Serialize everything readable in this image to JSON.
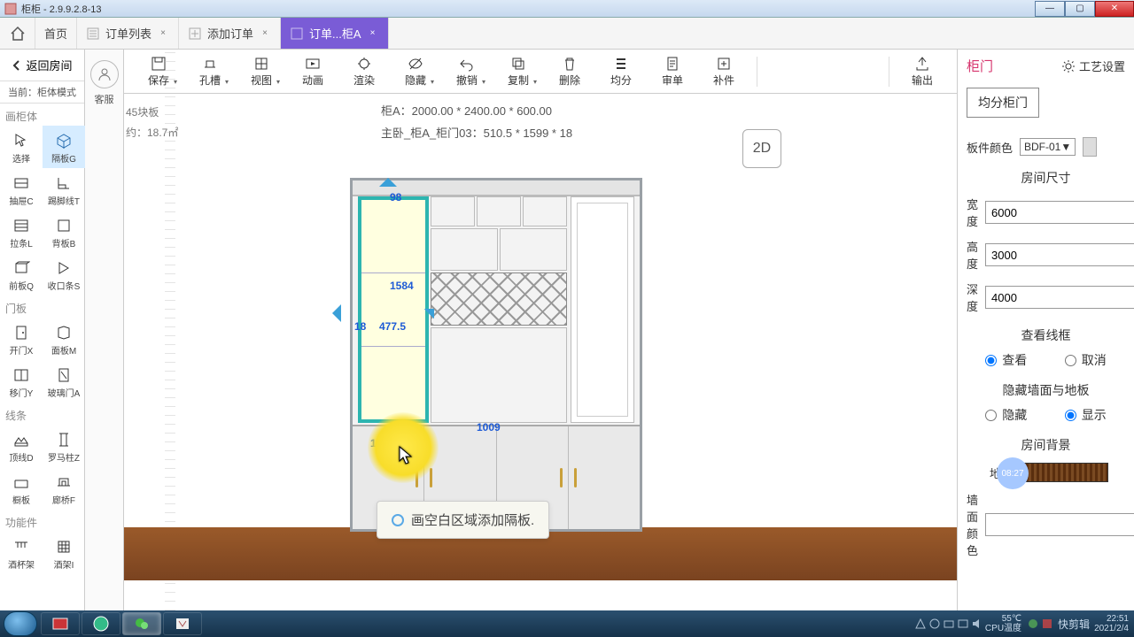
{
  "app": {
    "title": "柜柜 - 2.9.9.2.8-13"
  },
  "window_controls": {
    "min": "—",
    "max": "▢",
    "close": "✕"
  },
  "tabs": {
    "home": "首页",
    "list": {
      "label": "订单列表",
      "closable": true
    },
    "add": {
      "label": "添加订单",
      "closable": true
    },
    "active": {
      "label": "订单...柜A",
      "closable": true
    }
  },
  "left": {
    "back": "返回房间",
    "mode": "当前：柜体模式",
    "service": "客服",
    "sect_body": "画柜体",
    "tools_body": [
      [
        "选择",
        "隔板G"
      ],
      [
        "抽屉C",
        "踢脚线T"
      ],
      [
        "拉条L",
        "背板B"
      ],
      [
        "前板Q",
        "收口条S"
      ]
    ],
    "sect_door": "门板",
    "tools_door": [
      [
        "开门X",
        "面板M"
      ],
      [
        "移门Y",
        "玻璃门A"
      ]
    ],
    "sect_line": "线条",
    "tools_line": [
      [
        "顶线D",
        "罗马柱Z"
      ],
      [
        "橱板",
        "廊桥F"
      ]
    ],
    "sect_func": "功能件",
    "tools_func": [
      [
        "酒杯架",
        "酒架I"
      ]
    ],
    "stats": {
      "boards": "45块板",
      "area": "约：18.7㎡"
    }
  },
  "toolbar": {
    "items": [
      "保存",
      "孔槽",
      "视图",
      "动画",
      "渲染",
      "隐藏",
      "撤销",
      "复制",
      "删除",
      "均分",
      "审单",
      "补件"
    ],
    "dropdown": [
      true,
      true,
      true,
      false,
      false,
      true,
      true,
      true,
      false,
      false,
      false,
      false
    ],
    "export": "输出"
  },
  "canvas": {
    "line1": "柜A：2000.00 * 2400.00 * 600.00",
    "line2": "主卧_柜A_柜门03：510.5 * 1599 * 18",
    "view_mode": "2D",
    "dims": {
      "d98": "98",
      "d1584": "1584",
      "d18a": "18",
      "d477": "477.5",
      "d1009": "1009",
      "d18b": "18"
    },
    "tip": "画空白区域添加隔板."
  },
  "right": {
    "tab_main": "柜门",
    "proc": "工艺设置",
    "split": "均分柜门",
    "color_label": "板件颜色",
    "color_value": "BDF-01▼",
    "room_size": "房间尺寸",
    "width_l": "宽度",
    "width_v": "6000",
    "height_l": "高度",
    "height_v": "3000",
    "depth_l": "深度",
    "depth_v": "4000",
    "frame_head": "查看线框",
    "frame_yes": "查看",
    "frame_no": "取消",
    "hide_head": "隐藏墙面与地板",
    "hide_yes": "隐藏",
    "hide_no": "显示",
    "bg_head": "房间背景",
    "floor_l": "地板",
    "wall_l": "墙面颜色",
    "time_badge": "08:27"
  },
  "taskbar": {
    "temp": "55℃",
    "temp2": "CPU温度",
    "time": "22:51",
    "date": "2021/2/4",
    "brand": "快剪辑"
  }
}
